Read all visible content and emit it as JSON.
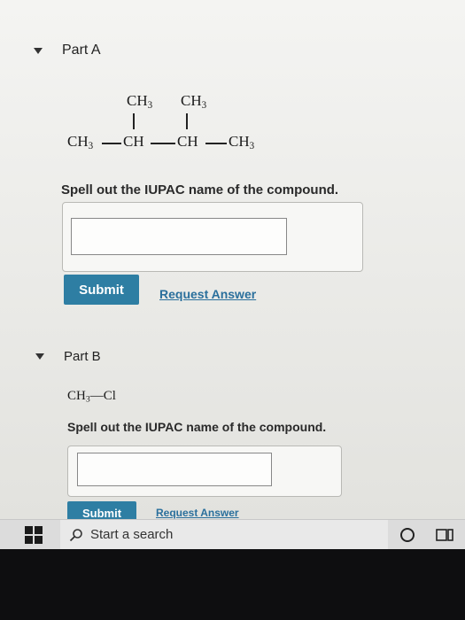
{
  "part_a": {
    "title": "Part A",
    "formula": {
      "branch_1": "CH",
      "branch_1_sub": "3",
      "branch_2": "CH",
      "branch_2_sub": "3",
      "main_1": "CH",
      "main_1_sub": "3",
      "main_2": "CH",
      "main_3": "CH",
      "main_4": "CH",
      "main_4_sub": "3"
    },
    "prompt": "Spell out the IUPAC name of the compound.",
    "answer_value": "",
    "submit_label": "Submit",
    "request_label": "Request Answer"
  },
  "part_b": {
    "title": "Part B",
    "formula": {
      "group_1": "CH",
      "group_1_sub": "3",
      "bond": "—",
      "group_2": "Cl"
    },
    "prompt": "Spell out the IUPAC name of the compound.",
    "answer_value": "",
    "submit_label": "Submit",
    "request_label": "Request Answer"
  },
  "taskbar": {
    "search_text": "Start a search"
  },
  "icons": {
    "caret": "caret-down-icon",
    "windows": "windows-logo-icon",
    "search": "search-icon",
    "cortana": "cortana-icon",
    "task_view": "task-view-icon"
  }
}
